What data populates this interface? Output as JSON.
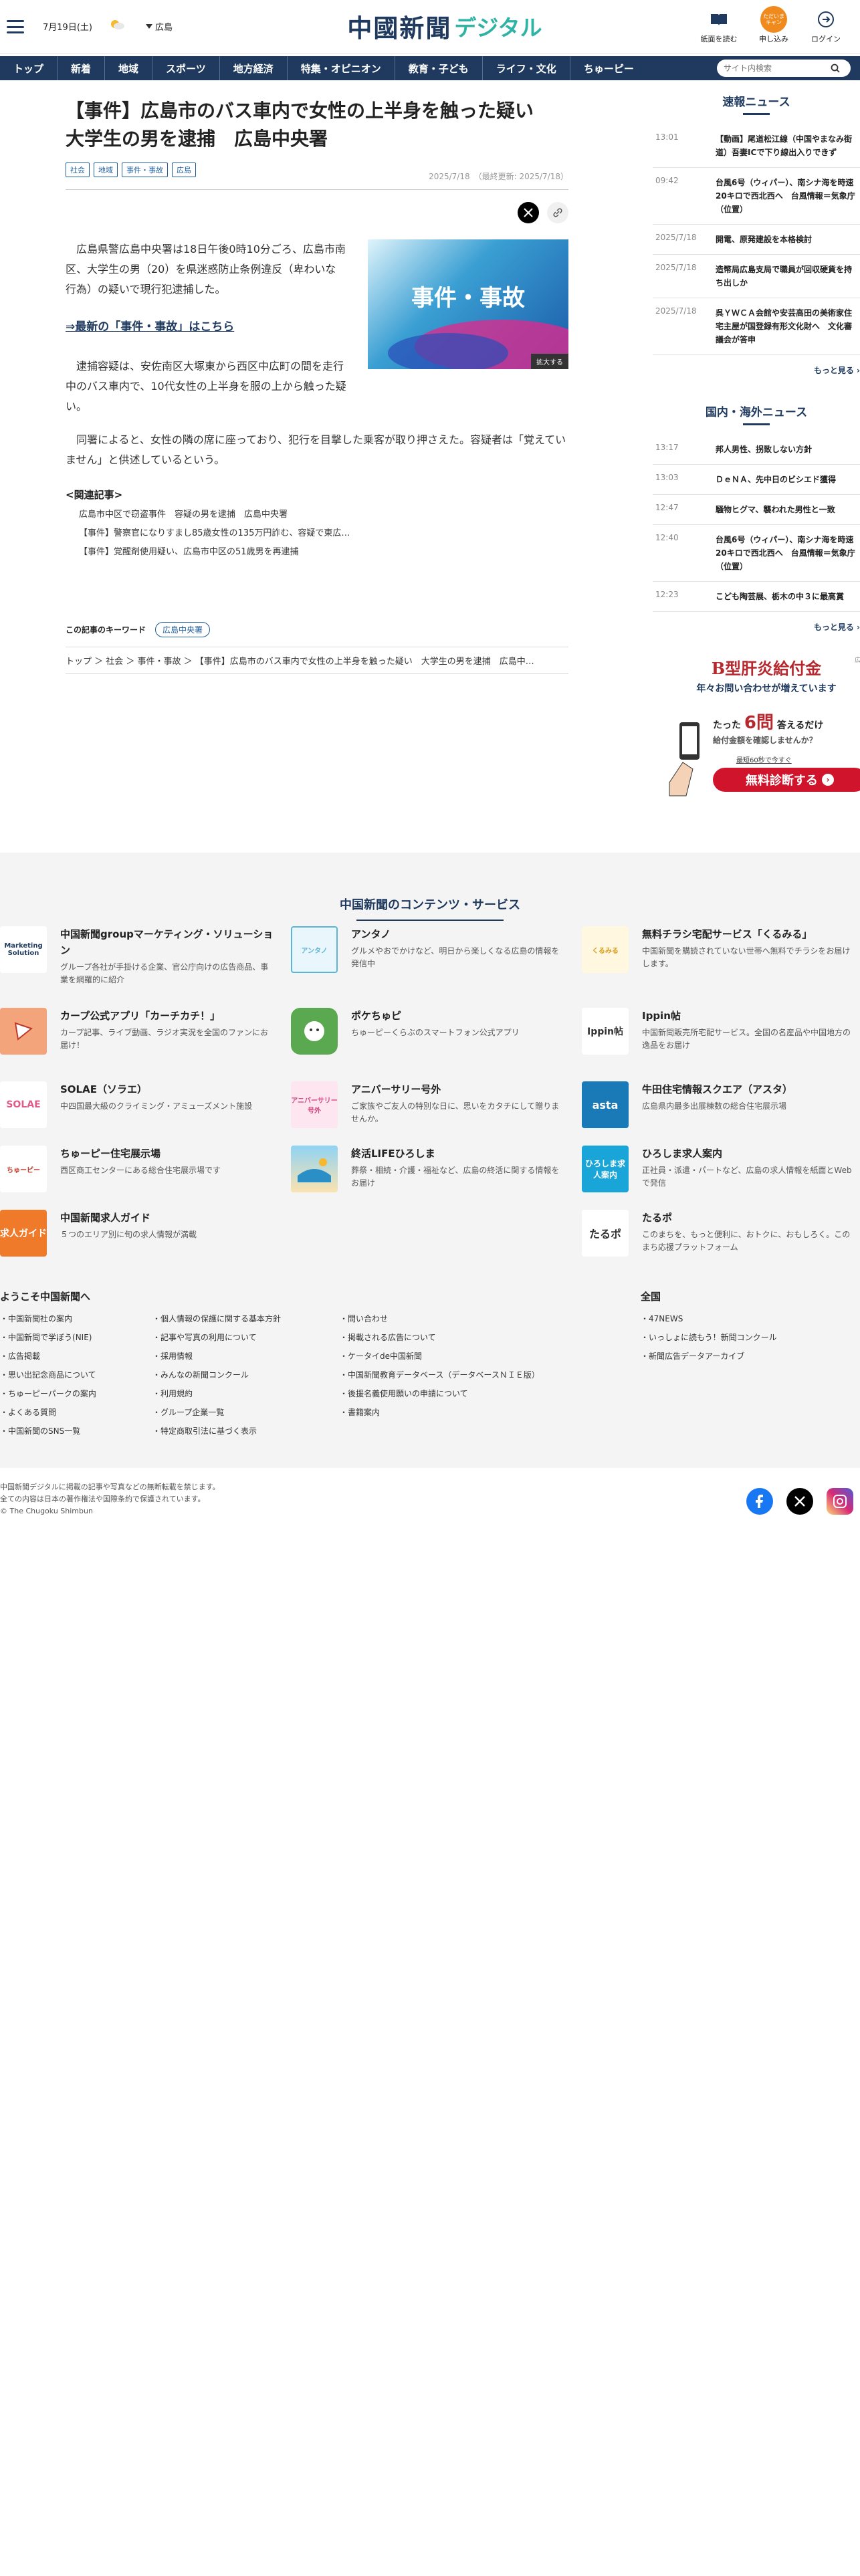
{
  "header": {
    "date": "7月19日(土)",
    "region": "広島",
    "logo_main": "中國新聞",
    "logo_sub": "デジタル",
    "buttons": [
      {
        "label": "紙面を読む"
      },
      {
        "label": "申し込み",
        "badge": "ただいまキャン"
      },
      {
        "label": "ログイン"
      }
    ]
  },
  "nav": {
    "items": [
      "トップ",
      "新着",
      "地域",
      "スポーツ",
      "地方経済",
      "特集・オピニオン",
      "教育・子ども",
      "ライフ・文化",
      "ちゅーピー"
    ],
    "search_placeholder": "サイト内検索"
  },
  "article": {
    "title": "【事件】広島市のバス車内で女性の上半身を触った疑い　大学生の男を逮捕　広島中央署",
    "tags": [
      "社会",
      "地域",
      "事件・事故",
      "広島"
    ],
    "date": "2025/7/18",
    "updated": "（最終更新: 2025/7/18）",
    "paragraph1": "　広島県警広島中央署は18日午後0時10分ごろ、広島市南区、大学生の男（20）を県迷惑防止条例違反（卑わいな行為）の疑いで現行犯逮捕した。",
    "latest_link": "⇒最新の「事件・事故」はこちら",
    "paragraph2": "　逮捕容疑は、安佐南区大塚東から西区中広町の間を走行中のバス車内で、10代女性の上半身を服の上から触った疑い。",
    "paragraph3": "　同署によると、女性の隣の席に座っており、犯行を目撃した乗客が取り押さえた。容疑者は「覚えていません」と供述しているという。",
    "photo_text": "事件・事故",
    "photo_enlarge": "拡大する",
    "related_title": "<関連記事>",
    "related": [
      "広島市中区で窃盗事件　容疑の男を逮捕　広島中央署",
      "【事件】警察官になりすまし85歳女性の135万円詐む、容疑で東広…",
      "【事件】覚醒剤使用疑い、広島市中区の51歳男を再逮捕"
    ],
    "keyword_label": "この記事のキーワード",
    "keyword": "広島中央署",
    "breadcrumb": "トップ ＞ 社会 ＞ 事件・事故 ＞ 【事件】広島市のバス車内で女性の上半身を触った疑い　大学生の男を逮捕　広島中…"
  },
  "sidebar": {
    "breaking_title": "速報ニュース",
    "breaking": [
      {
        "time": "13:01",
        "headline": "【動画】尾道松江線（中国やまなみ街道）吾妻ICで下り線出入りできず"
      },
      {
        "time": "09:42",
        "headline": "台風6号（ウィパー）、南シナ海を時速20キロで西北西へ　台風情報＝気象庁（位置）"
      },
      {
        "time": "2025/7/18",
        "headline": "開電、原発建設を本格検討"
      },
      {
        "time": "2025/7/18",
        "headline": "造幣局広島支局で職員が回収硬貨を持ち出しか"
      },
      {
        "time": "2025/7/18",
        "headline": "呉ＹＷＣＡ会館や安芸高田の美術家住宅主屋が国登録有形文化財へ　文化審議会が答申"
      }
    ],
    "more1": "もっと見る",
    "national_title": "国内・海外ニュース",
    "national": [
      {
        "time": "13:17",
        "headline": "邦人男性、拐致しない方針"
      },
      {
        "time": "13:03",
        "headline": "ＤｅＮＡ、先中日のビシエド獲得"
      },
      {
        "time": "12:47",
        "headline": "騒物ヒグマ、襲われた男性と一致"
      },
      {
        "time": "12:40",
        "headline": "台風6号（ウィパー）、南シナ海を時速20キロで西北西へ　台風情報＝気象庁（位置）"
      },
      {
        "time": "12:23",
        "headline": "こども陶芸展、栃木の中３に最高賞"
      }
    ],
    "more2": "もっと見る",
    "ad": {
      "label": "広告",
      "title": "B型肝炎給付金",
      "sub": "年々お問い合わせが増えています",
      "q1": "たった",
      "q2": "6問",
      "q3": "答えるだけ",
      "q4": "給付金額を確認しませんか？",
      "q5": "最短60秒で今すぐ",
      "cta": "無料診断する"
    }
  },
  "services": {
    "title": "中国新聞のコンテンツ・サービス",
    "items": [
      {
        "name": "中国新聞groupマーケティング・ソリューション",
        "desc": "グループ各社が手掛ける企業、官公庁向けの広告商品、事業を網羅的に紹介",
        "thumb": "Marketing Solution",
        "color": "#ffffff",
        "fg": "#1f3a5e"
      },
      {
        "name": "アンタノ",
        "desc": "グルメやおでかけなど、明日から楽しくなる広島の情報を発信中",
        "thumb": "アンタノ",
        "color": "#e9f6fb",
        "fg": "#5bb6d6"
      },
      {
        "name": "無料チラシ宅配サービス「くるみる」",
        "desc": "中国新聞を購読されていない世帯へ無料でチラシをお届けします。",
        "thumb": "くるみる",
        "color": "#fff7e0",
        "fg": "#d89c1a"
      },
      {
        "name": "カープ公式アプリ「カーチカチ！」",
        "desc": "カープ記事、ライブ動画、ラジオ実況を全国のファンにお届け！",
        "thumb": "",
        "color": "#f3a47a",
        "fg": "#c0392b"
      },
      {
        "name": "ポケちゅピ",
        "desc": "ちゅーピーくらぶのスマートフォン公式アプリ",
        "thumb": "",
        "color": "#5aa84f",
        "fg": "#ffffff"
      },
      {
        "name": "Ippin帖",
        "desc": "中国新聞販売所宅配サービス。全国の名産品や中国地方の逸品をお届け",
        "thumb": "Ippin帖",
        "color": "#ffffff",
        "fg": "#333333"
      },
      {
        "name": "SOLAE（ソラエ）",
        "desc": "中四国最大級のクライミング・アミューズメント施設",
        "thumb": "SOLAE",
        "color": "#ffffff",
        "fg": "#e05a8a"
      },
      {
        "name": "アニバーサリー号外",
        "desc": "ご家族やご友人の特別な日に、思いをカタチにして贈りませんか。",
        "thumb": "アニバーサリー号外",
        "color": "#fde6ef",
        "fg": "#d04a84"
      },
      {
        "name": "牛田住宅情報スクエア（アスタ）",
        "desc": "広島県内最多出展棟数の総合住宅展示場",
        "thumb": "asta",
        "color": "#1a7ab8",
        "fg": "#ffffff"
      },
      {
        "name": "ちゅーピー住宅展示場",
        "desc": "西区商工センターにある総合住宅展示場です",
        "thumb": "ちゅーピー",
        "color": "#ffffff",
        "fg": "#c0392b"
      },
      {
        "name": "終活LIFEひろしま",
        "desc": "葬祭・相続・介護・福祉など、広島の終活に関する情報をお届け",
        "thumb": "",
        "color": "#fbe3b0",
        "fg": "#2a8fc7"
      },
      {
        "name": "ひろしま求人案内",
        "desc": "正社員・派遣・パートなど、広島の求人情報を紙面とWebで発信",
        "thumb": "ひろしま求人案内",
        "color": "#1aa5d8",
        "fg": "#ffffff"
      },
      {
        "name": "中国新聞求人ガイド",
        "desc": "５つのエリア別に旬の求人情報が満載",
        "thumb": "求人ガイド",
        "color": "#ef7b2a",
        "fg": "#ffffff"
      },
      {
        "name": "たるポ",
        "desc": "このまちを、もっと便利に、おトクに、おもしろく。このまち応援プラットフォーム",
        "thumb": "たるポ",
        "color": "#ffffff",
        "fg": "#333333"
      }
    ]
  },
  "footer": {
    "welcome": "ようこそ中国新聞へ",
    "col1": [
      "中国新聞社の案内",
      "中国新聞で学ぼう(NIE)",
      "広告掲載",
      "思い出記念商品について",
      "ちゅーピーパークの案内",
      "よくある質問",
      "中国新聞のSNS一覧"
    ],
    "col2": [
      "個人情報の保護に関する基本方針",
      "記事や写真の利用について",
      "採用情報",
      "みんなの新聞コンクール",
      "利用規約",
      "グループ企業一覧",
      "特定商取引法に基づく表示"
    ],
    "col3": [
      "問い合わせ",
      "掲載される広告について",
      "ケータイde中国新聞",
      "中国新聞教育データベース（データベースＮＩＥ版）",
      "後援名義使用願いの申請について",
      "書籍案内"
    ],
    "national_title": "全国",
    "col4": [
      "47NEWS",
      "いっしょに読もう！新聞コンクール",
      "新聞広告データアーカイブ"
    ],
    "copyright": [
      "中国新聞デジタルに掲載の記事や写真などの無断転載を禁じます。",
      "全ての内容は日本の著作権法や国際条約で保護されています。",
      "© The Chugoku Shimbun"
    ],
    "colors": {
      "facebook": "#1877f2",
      "x": "#000000",
      "instagram": "#d6249f"
    }
  }
}
